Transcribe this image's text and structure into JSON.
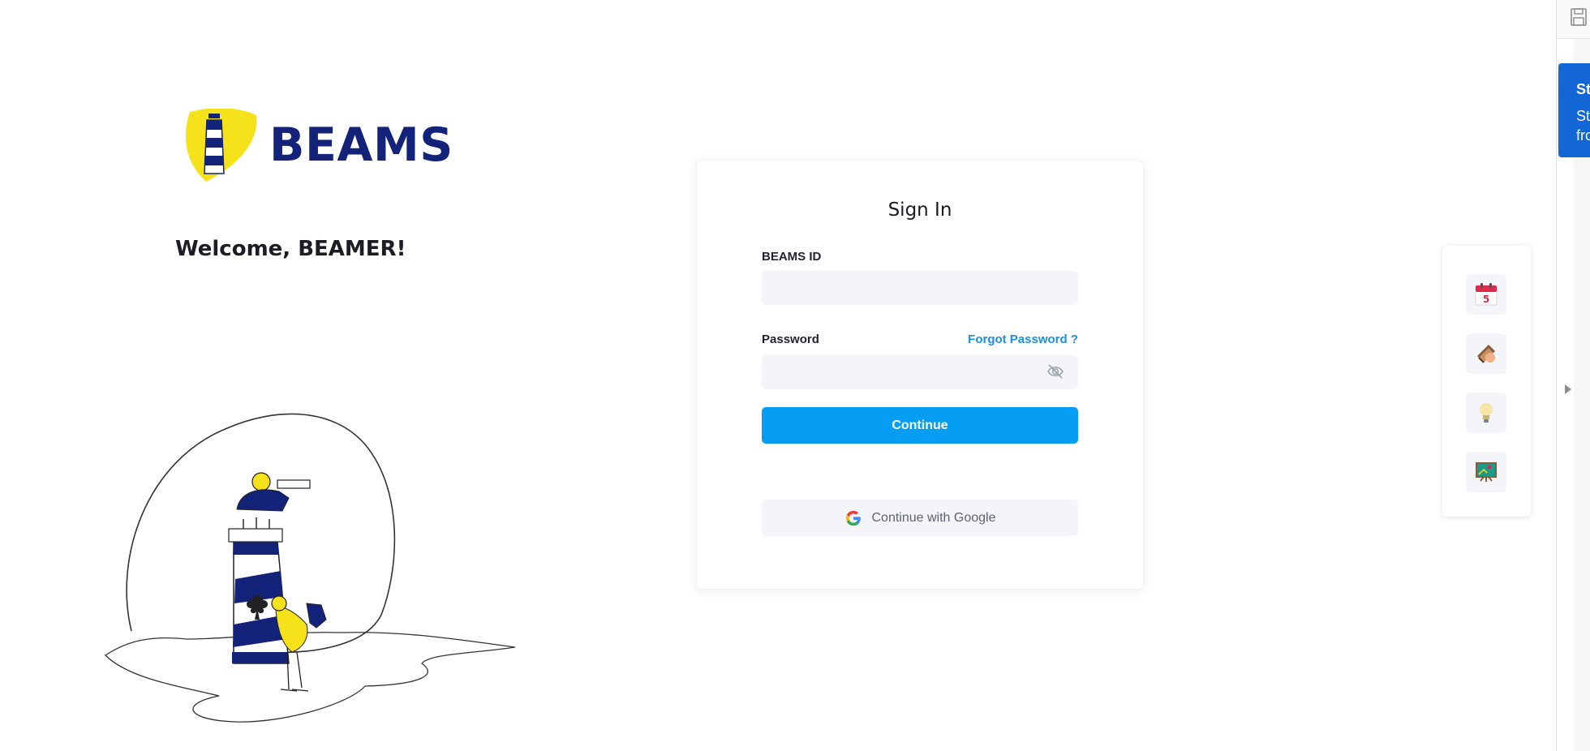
{
  "brand": {
    "name": "BEAMS",
    "colors": {
      "navy": "#14237a",
      "yellow": "#f6e21a"
    }
  },
  "welcome": "Welcome, BEAMER!",
  "signin": {
    "title": "Sign In",
    "id_label": "BEAMS ID",
    "id_value": "",
    "password_label": "Password",
    "password_value": "",
    "forgot_label": "Forgot Password ?",
    "continue_label": "Continue",
    "google_label": "Continue with Google"
  },
  "quick_panel": {
    "items": [
      {
        "icon": "calendar-icon",
        "text": "5"
      },
      {
        "icon": "book-icon"
      },
      {
        "icon": "lightbulb-icon"
      },
      {
        "icon": "presentation-board-icon"
      }
    ]
  },
  "extension": {
    "card_title": "St",
    "card_text_line1": "Sta",
    "card_text_line2": "fro"
  },
  "accent_colors": {
    "primary": "#069ef2",
    "link": "#1a8fe3",
    "field_bg": "#f3f5f8"
  }
}
